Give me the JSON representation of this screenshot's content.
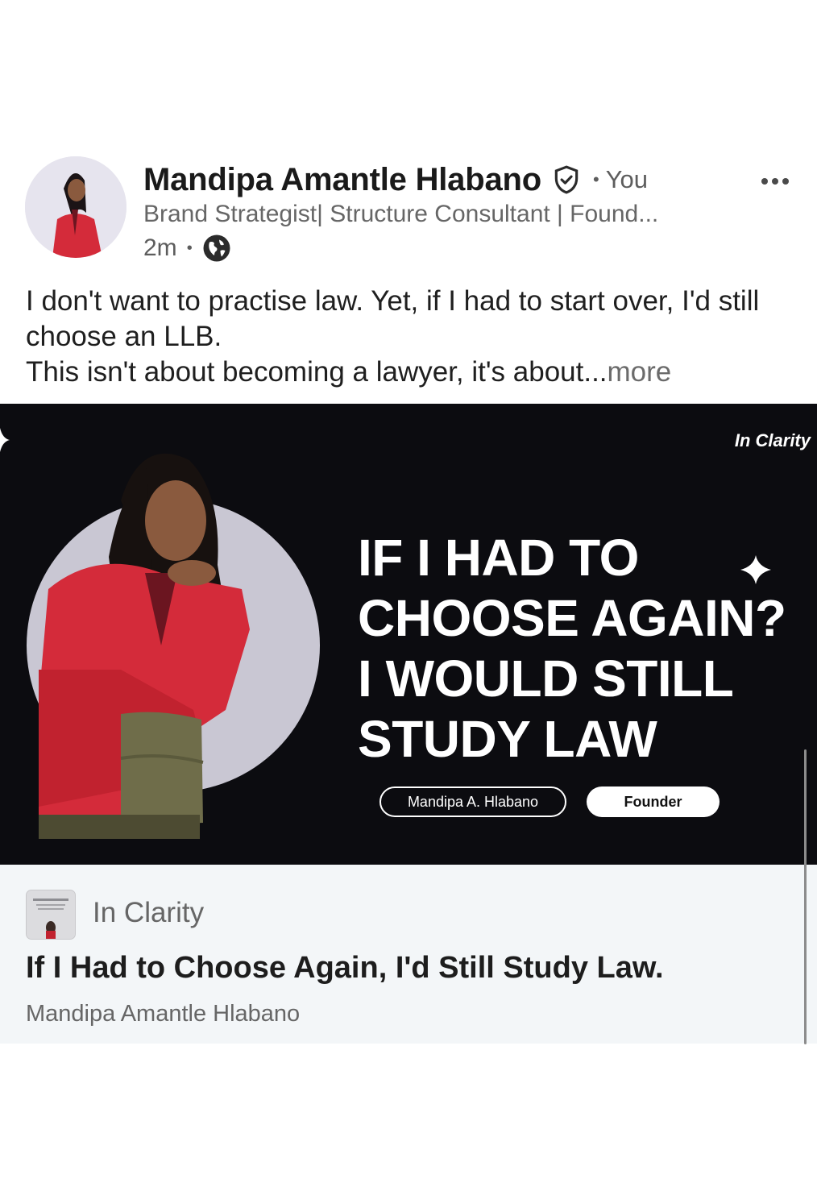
{
  "post": {
    "author": {
      "name": "Mandipa Amantle Hlabano",
      "relation": "You",
      "headline": "Brand Strategist| Structure Consultant | Found...",
      "time": "2m"
    },
    "text": {
      "line1": "I don't want to practise law. Yet, if I had to start over, I'd still choose an LLB.",
      "line2": "This isn't about becoming a lawyer, it's about...",
      "more": "more"
    },
    "media": {
      "brand": "In Clarity",
      "title_lines": [
        "IF I HAD TO",
        "CHOOSE AGAIN?",
        "I WOULD STILL",
        "STUDY LAW"
      ],
      "name_pill": "Mandipa A. Hlabano",
      "role_pill": "Founder"
    },
    "card": {
      "source": "In Clarity",
      "title": "If I Had to Choose Again, I'd Still Study Law.",
      "author": "Mandipa Amantle Hlabano"
    },
    "colors": {
      "media_bg": "#0c0c10",
      "card_bg": "#f3f6f8",
      "jacket_red": "#d42b3a",
      "circle_gray": "#c9c7d3"
    }
  }
}
